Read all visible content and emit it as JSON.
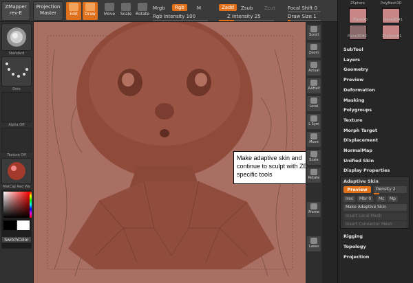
{
  "toolbar": {
    "zmapper": "ZMapper",
    "zmapper_rev": "rev-E",
    "projection": "Projection",
    "projection_sub": "Master",
    "tools": [
      {
        "label": "Edit",
        "active": true
      },
      {
        "label": "Draw",
        "active": true
      },
      {
        "label": "Move",
        "active": false
      },
      {
        "label": "Scale",
        "active": false
      },
      {
        "label": "Rotate",
        "active": false
      }
    ],
    "mrgb": "Mrgb",
    "rgb": "Rgb",
    "m": "M",
    "rgb_intensity": "Rgb Intensity 100",
    "zadd": "Zadd",
    "zsub": "Zsub",
    "zcut": "Zcut",
    "z_intensity": "Z Intensity 25",
    "focal_shift": "Focal Shift 0",
    "draw_size": "Draw Size 1"
  },
  "left_panel": {
    "standard": "Standard",
    "dots": "Dots",
    "alpha_off": "Alpha Off",
    "texture_off": "Texture Off",
    "matcap": "MatCap Red Wa",
    "switch_color": "SwitchColor"
  },
  "right_strip": [
    {
      "label": "Scroll",
      "icon": "scroll-icon"
    },
    {
      "label": "Zoom",
      "icon": "zoom-icon"
    },
    {
      "label": "Actual",
      "icon": "actual-icon"
    },
    {
      "label": "AAHalf",
      "icon": "aahalf-icon"
    },
    {
      "label": "Local",
      "icon": "local-icon"
    },
    {
      "label": "L.Sym",
      "icon": "lsym-icon"
    },
    {
      "label": "Move",
      "icon": "move-icon"
    },
    {
      "label": "Scale",
      "icon": "scale-icon"
    },
    {
      "label": "Rotate",
      "icon": "rotate-icon"
    },
    {
      "label": "Frame",
      "icon": "frame-icon"
    },
    {
      "label": "Lasso",
      "icon": "lasso-icon"
    }
  ],
  "subtool_thumbs": [
    {
      "label": "ZSphere",
      "color": "#3a3a3a"
    },
    {
      "label": "PolyMesh3D",
      "color": "#3a3a3a"
    },
    {
      "label": "Plane3D",
      "color": "#c98686"
    },
    {
      "label": "Plane3D#1",
      "color": "#c98686"
    },
    {
      "label": "Plane3D#2",
      "color": "#8a6a6a"
    },
    {
      "label": "ZSphere#1",
      "color": "#c98686"
    }
  ],
  "menu": {
    "items": [
      "SubTool",
      "Layers",
      "Geometry",
      "Preview",
      "Deformation",
      "Masking",
      "Polygroups",
      "Texture",
      "Morph Target",
      "Displacement",
      "NormalMap",
      "Unified Skin",
      "Display Properties"
    ],
    "adaptive_skin": "Adaptive Skin",
    "preview_btn": "Preview",
    "density": "Density 2",
    "ires": "Ires",
    "mbr": "Mbr 0",
    "mc": "Mc",
    "mp": "Mp",
    "make_adaptive": "Make Adaptive Skin",
    "insert_local": "Insert Local Mesh",
    "insert_connector": "Insert Connector Mesh",
    "bottom_items": [
      "Rigging",
      "Topology",
      "Projection"
    ]
  },
  "callout_text": "Make adaptive skin and continue to sculpt with ZBrush specific tools",
  "colors": {
    "accent": "#e0701a",
    "canvas": "#a86f62",
    "model": "#8f4a3a"
  }
}
